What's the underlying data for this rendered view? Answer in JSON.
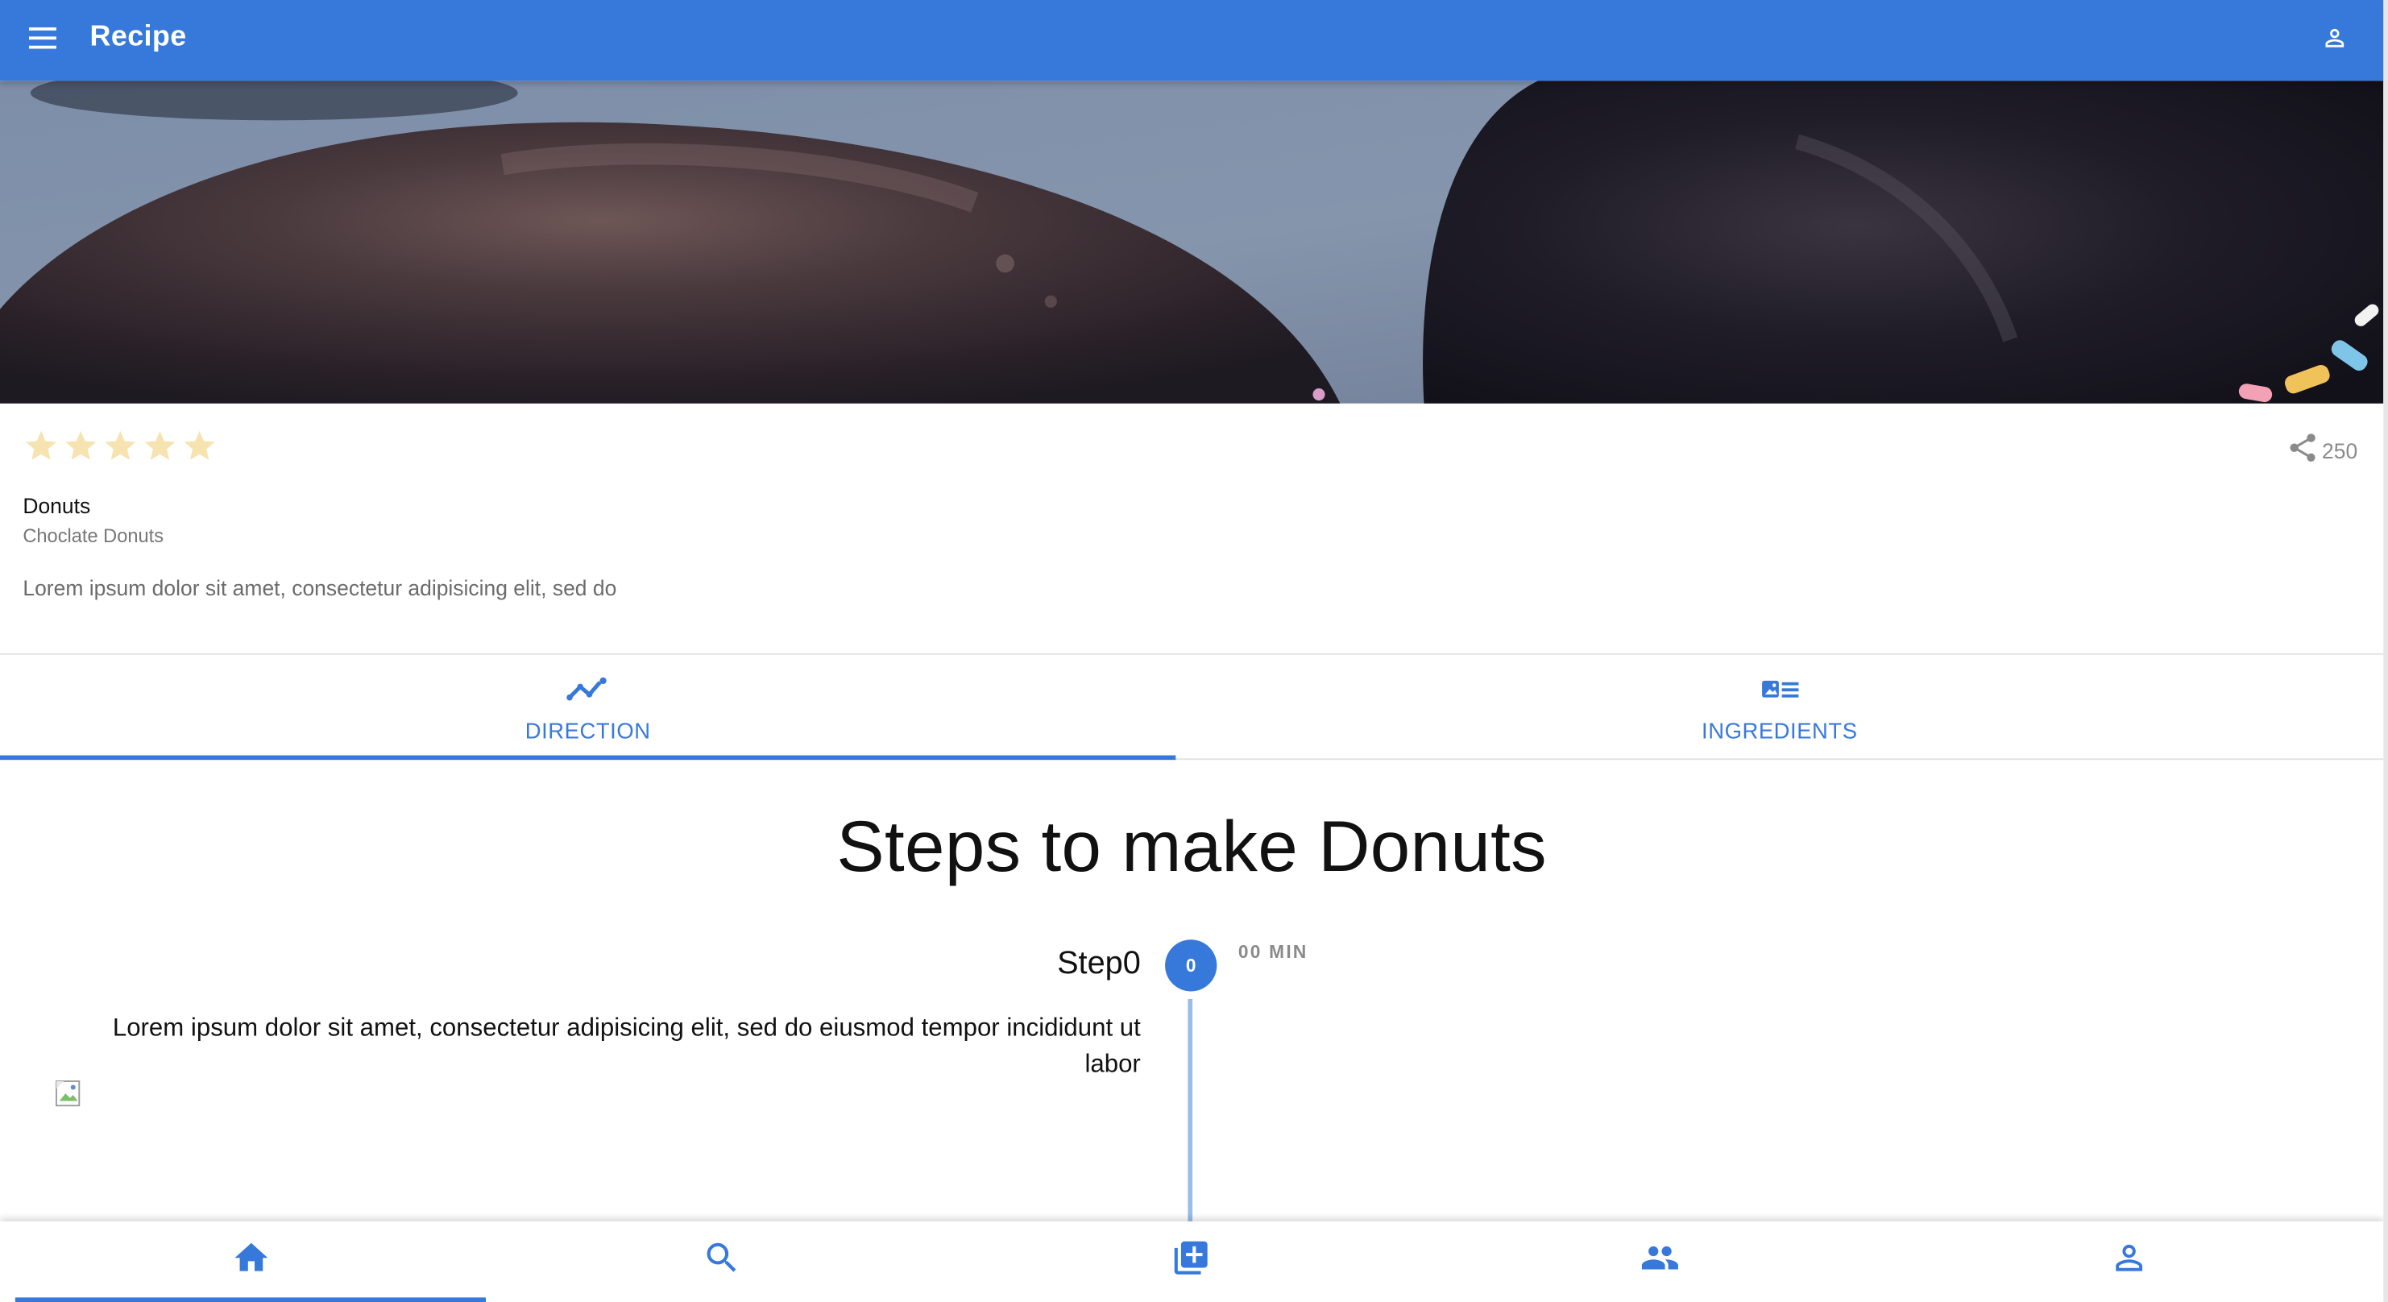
{
  "app_bar": {
    "title": "Recipe",
    "menu_icon": "menu-icon",
    "account_icon": "account-icon"
  },
  "recipe": {
    "rating": {
      "value": 0,
      "max": 5
    },
    "share_count": "250",
    "name": "Donuts",
    "subtitle": "Choclate Donuts",
    "description": "Lorem ipsum dolor sit amet, consectetur adipisicing elit, sed do"
  },
  "tabs": [
    {
      "label": "DIRECTION",
      "icon": "trending-icon",
      "active": true
    },
    {
      "label": "INGREDIENTS",
      "icon": "list-icon",
      "active": false
    }
  ],
  "steps": {
    "title": "Steps to make Donuts",
    "items": [
      {
        "label": "Step0",
        "number": "0",
        "time": "00 MIN",
        "text": "Lorem ipsum dolor sit amet, consectetur adipisicing elit, sed do eiusmod tempor incididunt ut labor"
      }
    ]
  },
  "bottom_nav": [
    {
      "name": "home",
      "icon": "home-icon",
      "active": true
    },
    {
      "name": "search",
      "icon": "search-icon",
      "active": false
    },
    {
      "name": "add",
      "icon": "add-box-icon",
      "active": false
    },
    {
      "name": "people",
      "icon": "people-icon",
      "active": false
    },
    {
      "name": "profile",
      "icon": "person-icon",
      "active": false
    }
  ],
  "colors": {
    "primary": "#3779db",
    "star": "#f7e3b0",
    "muted": "#8a8a8a"
  }
}
